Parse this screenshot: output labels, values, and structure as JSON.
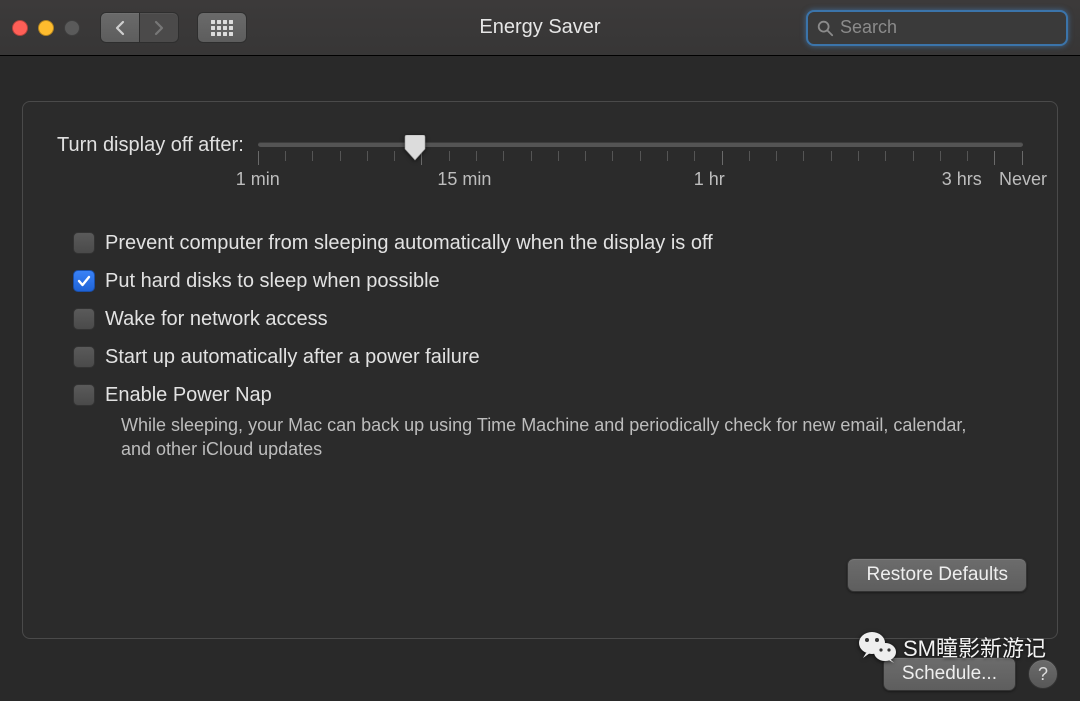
{
  "window": {
    "title": "Energy Saver",
    "search_placeholder": "Search"
  },
  "slider": {
    "label": "Turn display off after:",
    "value_percent": 20.5,
    "ticks": {
      "min": "1 min",
      "t15": "15 min",
      "t1hr": "1 hr",
      "t3hr": "3 hrs",
      "never": "Never"
    }
  },
  "options": [
    {
      "id": "prevent-sleep",
      "label": "Prevent computer from sleeping automatically when the display is off",
      "checked": false
    },
    {
      "id": "hard-disks-sleep",
      "label": "Put hard disks to sleep when possible",
      "checked": true
    },
    {
      "id": "wake-network",
      "label": "Wake for network access",
      "checked": false
    },
    {
      "id": "startup-power-failure",
      "label": "Start up automatically after a power failure",
      "checked": false
    },
    {
      "id": "power-nap",
      "label": "Enable Power Nap",
      "checked": false,
      "desc": "While sleeping, your Mac can back up using Time Machine and periodically check for new email, calendar, and other iCloud updates"
    }
  ],
  "buttons": {
    "restore": "Restore Defaults",
    "schedule": "Schedule...",
    "help": "?"
  },
  "watermark": "SM瞳影新游记"
}
